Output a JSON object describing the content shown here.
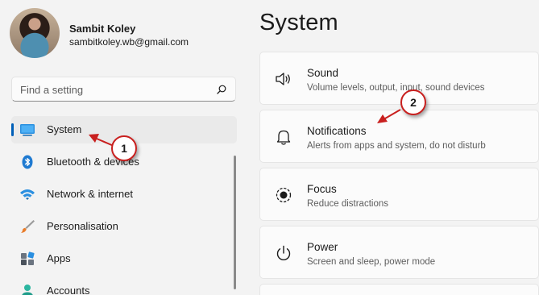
{
  "profile": {
    "name": "Sambit Koley",
    "email": "sambitkoley.wb@gmail.com"
  },
  "search": {
    "placeholder": "Find a setting",
    "icon": "search-icon"
  },
  "sidebar": {
    "items": [
      {
        "label": "System",
        "icon": "system-monitor-icon",
        "active": true
      },
      {
        "label": "Bluetooth & devices",
        "icon": "bluetooth-icon",
        "active": false
      },
      {
        "label": "Network & internet",
        "icon": "wifi-icon",
        "active": false
      },
      {
        "label": "Personalisation",
        "icon": "paintbrush-icon",
        "active": false
      },
      {
        "label": "Apps",
        "icon": "apps-icon",
        "active": false
      },
      {
        "label": "Accounts",
        "icon": "accounts-icon",
        "active": false
      }
    ]
  },
  "main": {
    "title": "System",
    "cards": [
      {
        "title": "Sound",
        "description": "Volume levels, output, input, sound devices",
        "icon": "speaker-icon"
      },
      {
        "title": "Notifications",
        "description": "Alerts from apps and system, do not disturb",
        "icon": "bell-icon"
      },
      {
        "title": "Focus",
        "description": "Reduce distractions",
        "icon": "focus-icon"
      },
      {
        "title": "Power",
        "description": "Screen and sleep, power mode",
        "icon": "power-icon"
      }
    ]
  },
  "annotations": {
    "step1": "1",
    "step2": "2"
  },
  "colors": {
    "accent": "#005fb8",
    "callout_border": "#c9201f",
    "arrow": "#c9201f",
    "window_bg": "#f3f3f3",
    "card_bg": "#fbfbfb"
  }
}
